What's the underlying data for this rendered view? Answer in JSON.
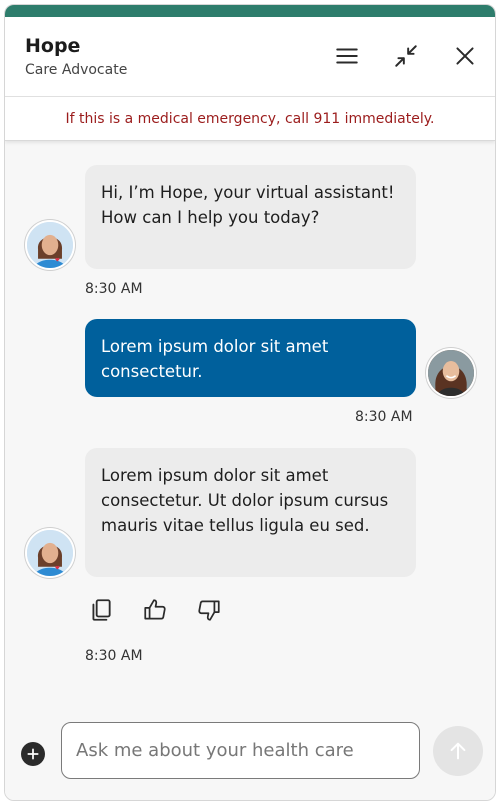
{
  "header": {
    "title": "Hope",
    "subtitle": "Care Advocate",
    "icons": [
      "menu-icon",
      "minimize-icon",
      "close-icon"
    ]
  },
  "banner": {
    "text": "If this is a medical emergency, call 911 immediately."
  },
  "messages": [
    {
      "sender": "bot",
      "text": "Hi, I’m Hope, your virtual assistant! How can I help you today?",
      "time": "8:30 AM"
    },
    {
      "sender": "user",
      "text": "Lorem ipsum dolor sit amet consectetur.",
      "time": "8:30 AM"
    },
    {
      "sender": "bot",
      "text": "Lorem ipsum dolor sit amet consectetur. Ut dolor ipsum cursus mauris vitae tellus ligula eu sed.",
      "time": "8:30 AM"
    }
  ],
  "message_actions": [
    "copy-icon",
    "thumbs-up-icon",
    "thumbs-down-icon"
  ],
  "composer": {
    "placeholder": "Ask me about your health care",
    "attach_icon": "plus-icon",
    "send_icon": "arrow-up-icon"
  },
  "colors": {
    "accent_top": "#2e7d6c",
    "user_bubble": "#00609c",
    "bot_bubble": "#ececec",
    "emergency_text": "#9b1c1c"
  }
}
